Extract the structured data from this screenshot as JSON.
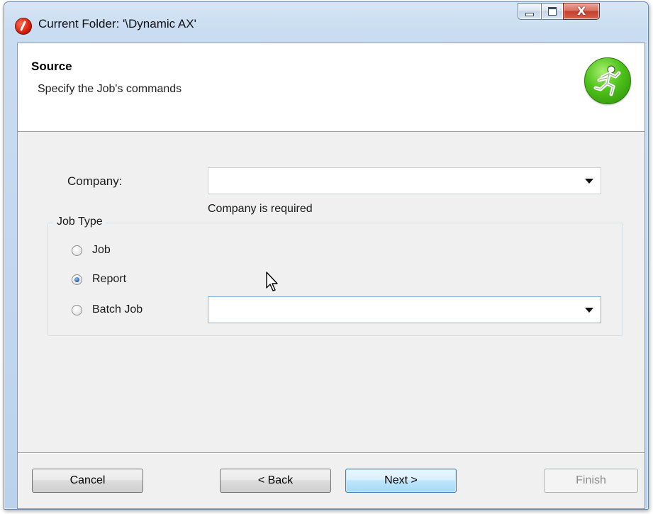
{
  "window": {
    "title": "Current Folder: '\\Dynamic AX'",
    "controls": {
      "minimize": "minimize",
      "maximize": "maximize",
      "close": "X"
    }
  },
  "header": {
    "title": "Source",
    "subtitle": "Specify the Job's commands",
    "icon": "running-man-icon"
  },
  "form": {
    "company_label": "Company:",
    "company_value": "",
    "company_error": "Company is required",
    "job_type_legend": "Job Type",
    "options": [
      {
        "label": "Job",
        "checked": false
      },
      {
        "label": "Report",
        "checked": true
      },
      {
        "label": "Batch Job",
        "checked": false
      }
    ],
    "batch_job_value": ""
  },
  "buttons": {
    "cancel": "Cancel",
    "back": "< Back",
    "next": "Next >",
    "finish": "Finish",
    "finish_enabled": false
  },
  "colors": {
    "header_icon": "#4ec21a",
    "app_icon": "#d71f0c",
    "next_button_border": "#3c7fb1"
  }
}
